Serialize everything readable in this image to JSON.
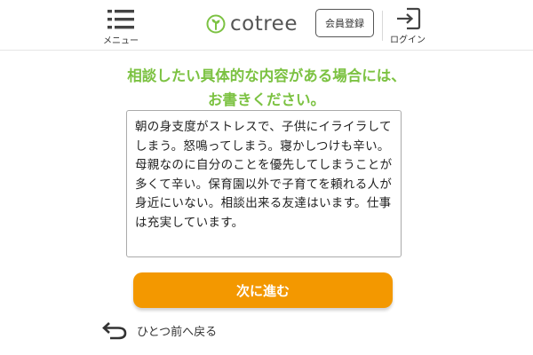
{
  "header": {
    "menu_label": "メニュー",
    "logo_text": "cotree",
    "register_label": "会員登録",
    "login_label": "ログイン"
  },
  "heading": {
    "line1": "相談したい具体的な内容がある場合には、",
    "line2": "お書きください。"
  },
  "consult": {
    "text": "朝の身支度がストレスで、子供にイライラしてしまう。怒鳴ってしまう。寝かしつけも辛い。母親なのに自分のことを優先してしまうことが多くて辛い。保育園以外で子育てを頼れる人が身近にいない。相談出来る友達はいます。仕事は充実しています。"
  },
  "actions": {
    "next_label": "次に進む",
    "back_label": "ひとつ前へ戻る"
  },
  "colors": {
    "accent_green": "#7cc242",
    "button_orange": "#f39800"
  },
  "icons": {
    "menu": "hamburger-icon",
    "logo": "sprout-icon",
    "login": "login-arrow-icon",
    "back": "undo-arrow-icon"
  }
}
